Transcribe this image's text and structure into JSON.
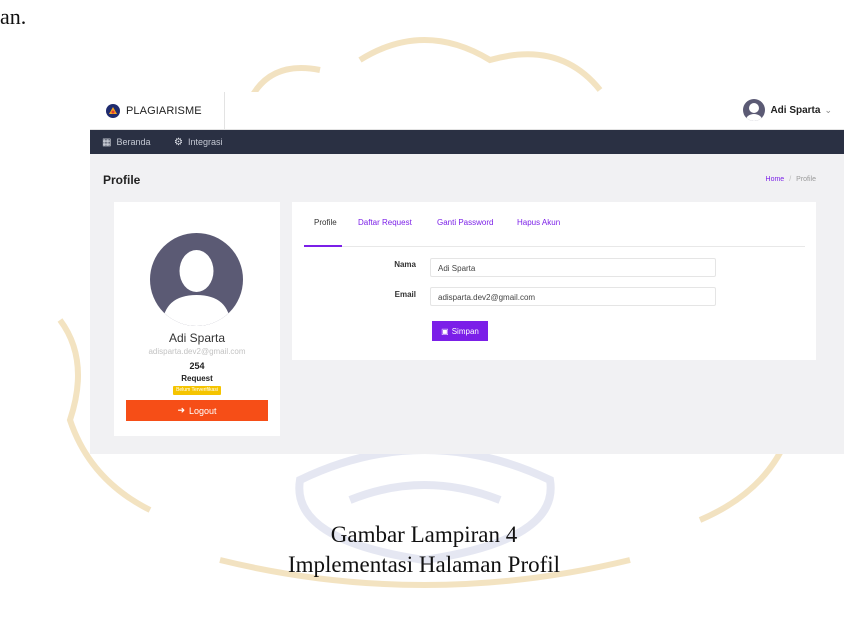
{
  "doc_fragment": "an.",
  "screenshot": {
    "brand": {
      "name": "PLAGIARISME",
      "logo_icon": "university-logo"
    },
    "user_menu": {
      "name": "Adi Sparta",
      "chevron": "⌄"
    },
    "nav": [
      {
        "label": "Beranda",
        "icon": "grid-icon"
      },
      {
        "label": "Integrasi",
        "icon": "gears-icon"
      }
    ],
    "page_title": "Profile",
    "breadcrumb": {
      "home": "Home",
      "separator": "/",
      "current": "Profile"
    },
    "profile_card": {
      "name": "Adi Sparta",
      "email": "adisparta.dev2@gmail.com",
      "request_count": "254",
      "request_label": "Request",
      "badge": "Belum Terverifikasi",
      "logout_label": "Logout"
    },
    "tabs": [
      "Profile",
      "Daftar Request",
      "Ganti Password",
      "Hapus Akun"
    ],
    "form": {
      "nama_label": "Nama",
      "nama_value": "Adi Sparta",
      "email_label": "Email",
      "email_value": "adisparta.dev2@gmail.com",
      "save_label": "Simpan"
    },
    "colors": {
      "accent": "#7b1fe8",
      "navbar": "#2a3043",
      "logout": "#f64e17",
      "badge": "#f5c400"
    }
  },
  "caption": {
    "line1": "Gambar Lampiran 4",
    "line2": "Implementasi Halaman Profil"
  }
}
